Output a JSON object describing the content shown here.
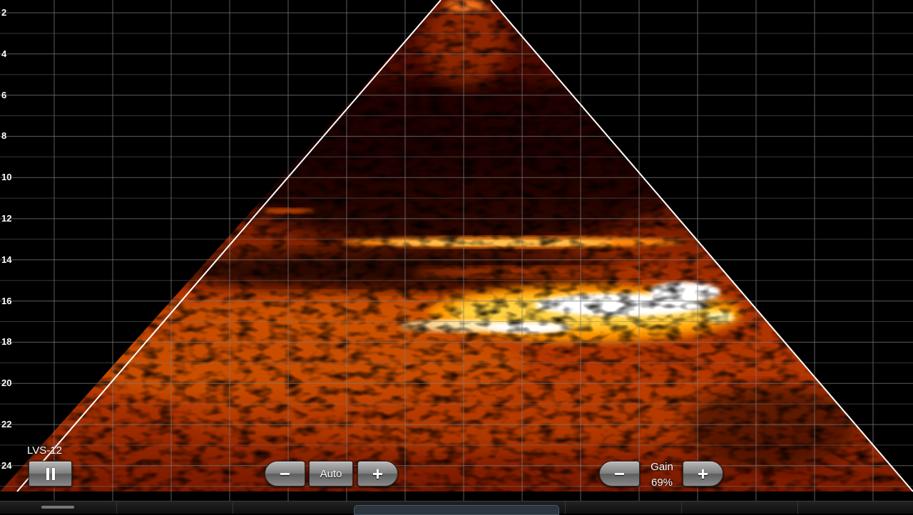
{
  "probe": {
    "name": "LVS-12"
  },
  "depth_scale": {
    "labels": [
      "2",
      "4",
      "6",
      "8",
      "10",
      "12",
      "14",
      "16",
      "18",
      "20",
      "22",
      "24"
    ]
  },
  "controls": {
    "depth_decrease_label": "−",
    "depth_mode_label": "Auto",
    "depth_increase_label": "+",
    "gain_decrease_label": "−",
    "gain_title": "Gain",
    "gain_value": "69%",
    "gain_increase_label": "+",
    "pause_icon": "pause-icon"
  },
  "colors": {
    "grid": "#7a7a7a",
    "sector_edge": "#ffffff",
    "image_palette": [
      "#1a0000",
      "#7a1000",
      "#d24a00",
      "#ff9a00",
      "#ffe080",
      "#ffffff"
    ]
  }
}
